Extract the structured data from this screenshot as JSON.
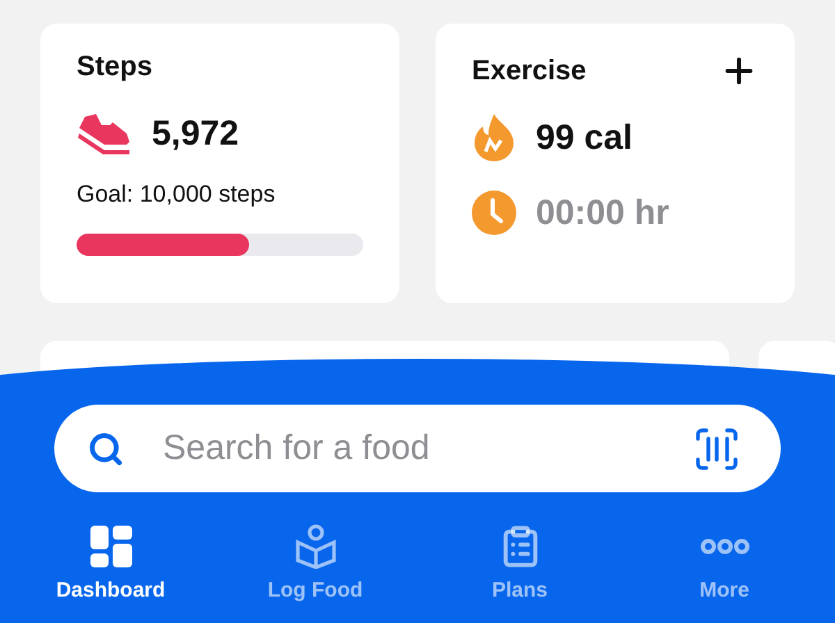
{
  "cards": [
    {
      "kind": "steps",
      "title": "Steps",
      "value": "5,972",
      "goal": "Goal: 10,000 steps",
      "level": 0.6
    },
    {
      "kind": "exercise",
      "title": "Exercise",
      "calories": "99 cal",
      "duration": "00:00 hr"
    }
  ],
  "search": {
    "placeholder": "Search for a food"
  },
  "tabs": [
    {
      "label": "Dashboard",
      "selected": true
    },
    {
      "label": "Log Food",
      "selected": false
    },
    {
      "label": "Plans",
      "selected": false
    },
    {
      "label": "More",
      "selected": false
    }
  ]
}
